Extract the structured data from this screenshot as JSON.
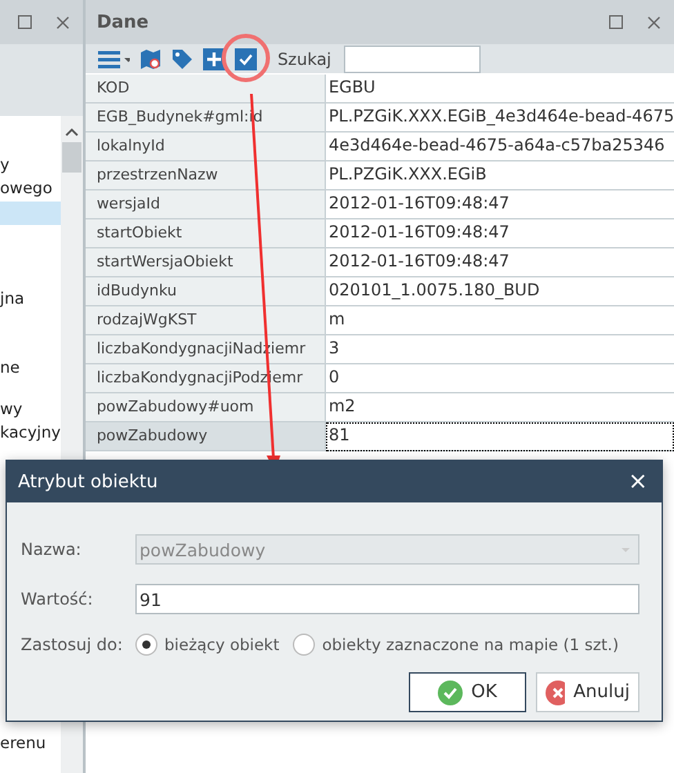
{
  "left_panel": {
    "fragments": [
      {
        "text": "y",
        "selected": false
      },
      {
        "text": "owego",
        "selected": false
      },
      {
        "selected": true
      },
      {
        "text": "jna",
        "selected": false
      },
      {
        "text": "ne",
        "selected": false
      },
      {
        "text": "wy",
        "selected": false
      },
      {
        "text": "kacyjny",
        "selected": false
      }
    ],
    "bottom_fragment": "erenu"
  },
  "data_panel": {
    "title": "Dane",
    "search_label": "Szukaj",
    "rows": [
      {
        "key": "KOD",
        "value": "EGBU",
        "selected": false
      },
      {
        "key": "EGB_Budynek#gml:id",
        "value": "PL.PZGiK.XXX.EGiB_4e3d464e-bead-4675",
        "selected": false
      },
      {
        "key": "lokalnyId",
        "value": "4e3d464e-bead-4675-a64a-c57ba25346",
        "selected": false
      },
      {
        "key": "przestrzenNazw",
        "value": "PL.PZGiK.XXX.EGiB",
        "selected": false
      },
      {
        "key": "wersjaId",
        "value": "2012-01-16T09:48:47",
        "selected": false
      },
      {
        "key": "startObiekt",
        "value": "2012-01-16T09:48:47",
        "selected": false
      },
      {
        "key": "startWersjaObiekt",
        "value": "2012-01-16T09:48:47",
        "selected": false
      },
      {
        "key": "idBudynku",
        "value": "020101_1.0075.180_BUD",
        "selected": false
      },
      {
        "key": "rodzajWgKST",
        "value": "m",
        "selected": false
      },
      {
        "key": "liczbaKondygnacjiNadziemr",
        "value": "3",
        "selected": false
      },
      {
        "key": "liczbaKondygnacjiPodziemr",
        "value": "0",
        "selected": false
      },
      {
        "key": "powZabudowy#uom",
        "value": "m2",
        "selected": false
      },
      {
        "key": "powZabudowy",
        "value": "81",
        "selected": true
      }
    ]
  },
  "dialog": {
    "title": "Atrybut obiektu",
    "close": "×",
    "name_label": "Nazwa:",
    "name_value": "powZabudowy",
    "value_label": "Wartość:",
    "value": "91",
    "apply_label": "Zastosuj do:",
    "options": [
      {
        "label": "bieżący obiekt",
        "selected": true
      },
      {
        "label": "obiekty zaznaczone na mapie (1 szt.)",
        "selected": false
      }
    ],
    "buttons": [
      {
        "label": "OK",
        "kind": "ok"
      },
      {
        "label": "Anuluj",
        "kind": "cancel"
      }
    ]
  }
}
